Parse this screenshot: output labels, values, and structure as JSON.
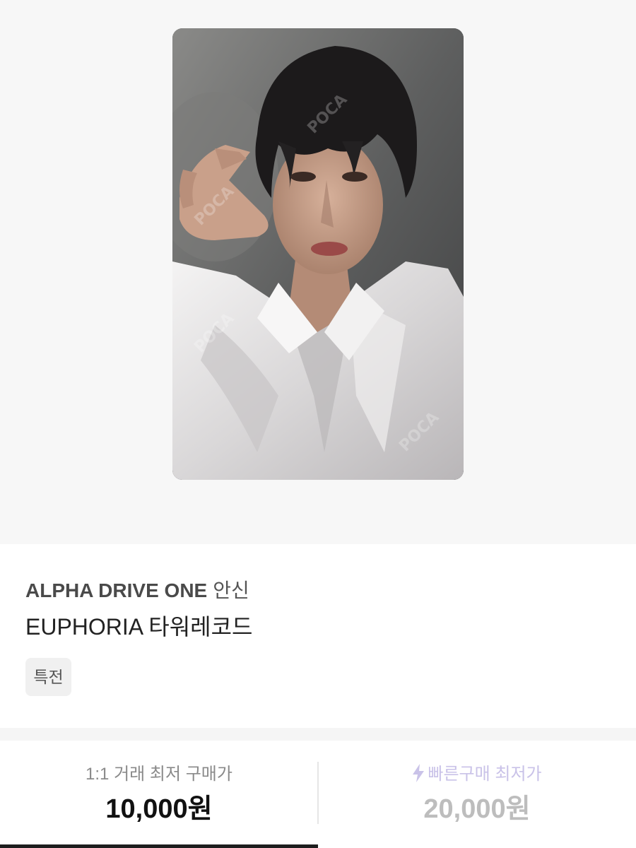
{
  "product": {
    "artist": "ALPHA DRIVE ONE",
    "safe_label": "안신",
    "title": "EUPHORIA 타워레코드",
    "tag": "특전",
    "image_icon": "photocard-image"
  },
  "prices": {
    "one_to_one": {
      "label": "1:1 거래 최저 구매가",
      "value": "10,000원"
    },
    "quick_buy": {
      "label": "빠른구매 최저가",
      "value": "20,000원",
      "icon": "lightning-bolt-icon",
      "accent": "#c9c2e8"
    }
  },
  "colors": {
    "active_tab": "#1e1e1e",
    "hero_bg": "#f7f7f7"
  }
}
